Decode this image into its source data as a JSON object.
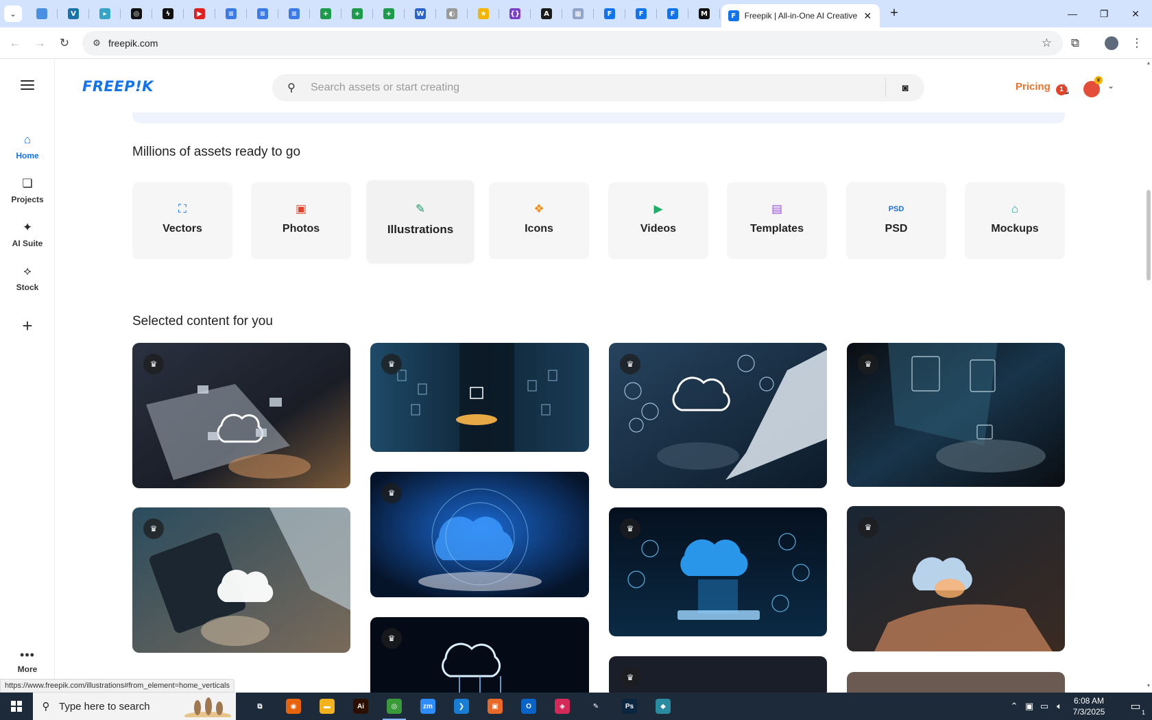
{
  "browser": {
    "tab_title": "Freepik | All-in-One AI Creative",
    "url": "freepik.com",
    "status_url": "https://www.freepik.com/illustrations#from_element=home_verticals",
    "pinned_tabs": [
      {
        "icon": "globe-icon",
        "color": "#4a90e2",
        "glyph": ""
      },
      {
        "icon": "brand-icon",
        "color": "#1a73a8",
        "glyph": "V"
      },
      {
        "icon": "app-icon",
        "color": "#36a3c7",
        "glyph": "▸"
      },
      {
        "icon": "openai-icon",
        "color": "#111111",
        "glyph": "◎"
      },
      {
        "icon": "bolt-icon",
        "color": "#111111",
        "glyph": "ϟ"
      },
      {
        "icon": "youtube-icon",
        "color": "#e02020",
        "glyph": "▶"
      },
      {
        "icon": "docs-icon",
        "color": "#3c7be6",
        "glyph": "≡"
      },
      {
        "icon": "docs-icon",
        "color": "#3c7be6",
        "glyph": "≡"
      },
      {
        "icon": "docs-icon",
        "color": "#3c7be6",
        "glyph": "≡"
      },
      {
        "icon": "sheets-icon",
        "color": "#1e9a4b",
        "glyph": "+"
      },
      {
        "icon": "sheets-icon",
        "color": "#1e9a4b",
        "glyph": "+"
      },
      {
        "icon": "sheets-icon",
        "color": "#1e9a4b",
        "glyph": "+"
      },
      {
        "icon": "word-icon",
        "color": "#2b65c9",
        "glyph": "W"
      },
      {
        "icon": "globe-icon",
        "color": "#9a9a9a",
        "glyph": "◐"
      },
      {
        "icon": "star-icon",
        "color": "#f4b400",
        "glyph": "★"
      },
      {
        "icon": "code-icon",
        "color": "#7a3fc8",
        "glyph": "{}"
      },
      {
        "icon": "app-icon",
        "color": "#1b1b1b",
        "glyph": "A"
      },
      {
        "icon": "grid-icon",
        "color": "#8fa4c8",
        "glyph": "▦"
      },
      {
        "icon": "freepik-icon",
        "color": "#1273eb",
        "glyph": "F"
      },
      {
        "icon": "freepik-icon",
        "color": "#1273eb",
        "glyph": "F"
      },
      {
        "icon": "freepik-icon",
        "color": "#1273eb",
        "glyph": "F"
      },
      {
        "icon": "m-icon",
        "color": "#111111",
        "glyph": "M"
      }
    ]
  },
  "sidebar": {
    "items": [
      {
        "label": "Home",
        "icon": "home-icon"
      },
      {
        "label": "Projects",
        "icon": "projects-icon"
      },
      {
        "label": "AI Suite",
        "icon": "sparkle-icon"
      },
      {
        "label": "Stock",
        "icon": "stock-icon"
      }
    ],
    "more_label": "More"
  },
  "header": {
    "logo": "FREEP!K",
    "search_placeholder": "Search assets or start creating",
    "pricing": "Pricing",
    "notification_count": "1"
  },
  "sections": {
    "assets_title": "Millions of assets ready to go",
    "selected_title": "Selected content for you"
  },
  "categories": [
    {
      "label": "Vectors",
      "icon": "vectors-icon",
      "color": "#1273eb"
    },
    {
      "label": "Photos",
      "icon": "photos-icon",
      "color": "#e4432b"
    },
    {
      "label": "Illustrations",
      "icon": "illustrations-icon",
      "color": "#1f9a6a"
    },
    {
      "label": "Icons",
      "icon": "icons-icon",
      "color": "#f08c1a"
    },
    {
      "label": "Videos",
      "icon": "videos-icon",
      "color": "#1fae6a"
    },
    {
      "label": "Templates",
      "icon": "templates-icon",
      "color": "#9a4fd6"
    },
    {
      "label": "PSD",
      "icon": "psd-icon",
      "color": "#1b6fd6"
    },
    {
      "label": "Mockups",
      "icon": "mockups-icon",
      "color": "#1aa39a"
    }
  ],
  "gallery": [
    {
      "name": "cloud-laptop-folders"
    },
    {
      "name": "ai-hand-documents"
    },
    {
      "name": "laptop-cloud-upload"
    },
    {
      "name": "laptop-security-lock"
    },
    {
      "name": "tablet-cloud-upload-download"
    },
    {
      "name": "hands-holding-cloud-network"
    },
    {
      "name": "tablet-cloud-hologram"
    },
    {
      "name": "hand-cloud-sync"
    },
    {
      "name": "cloud-circuit"
    }
  ],
  "taskbar": {
    "search_text": "Type here to search",
    "time": "6:08 AM",
    "date": "7/3/2025",
    "notification_count": "1",
    "apps": [
      {
        "name": "task-view",
        "color": "#1c2a3a",
        "glyph": "⧉"
      },
      {
        "name": "firefox",
        "color": "#e8640c",
        "glyph": "◉"
      },
      {
        "name": "file-explorer",
        "color": "#f2b21e",
        "glyph": "▬"
      },
      {
        "name": "illustrator",
        "color": "#2d0f00",
        "glyph": "Ai"
      },
      {
        "name": "chrome",
        "color": "#3a9a3a",
        "glyph": "◎"
      },
      {
        "name": "zoom",
        "color": "#2d8cff",
        "glyph": "zm"
      },
      {
        "name": "vscode",
        "color": "#1a7dd4",
        "glyph": "❯"
      },
      {
        "name": "app-orange",
        "color": "#e86a2a",
        "glyph": "▣"
      },
      {
        "name": "outlook",
        "color": "#0a64c8",
        "glyph": "O"
      },
      {
        "name": "creative-cloud",
        "color": "#d42a5a",
        "glyph": "◈"
      },
      {
        "name": "pen-tool",
        "color": "#1c2a3a",
        "glyph": "✎"
      },
      {
        "name": "photoshop",
        "color": "#0a2540",
        "glyph": "Ps"
      },
      {
        "name": "app-teal",
        "color": "#2a8aa0",
        "glyph": "◆"
      }
    ]
  }
}
